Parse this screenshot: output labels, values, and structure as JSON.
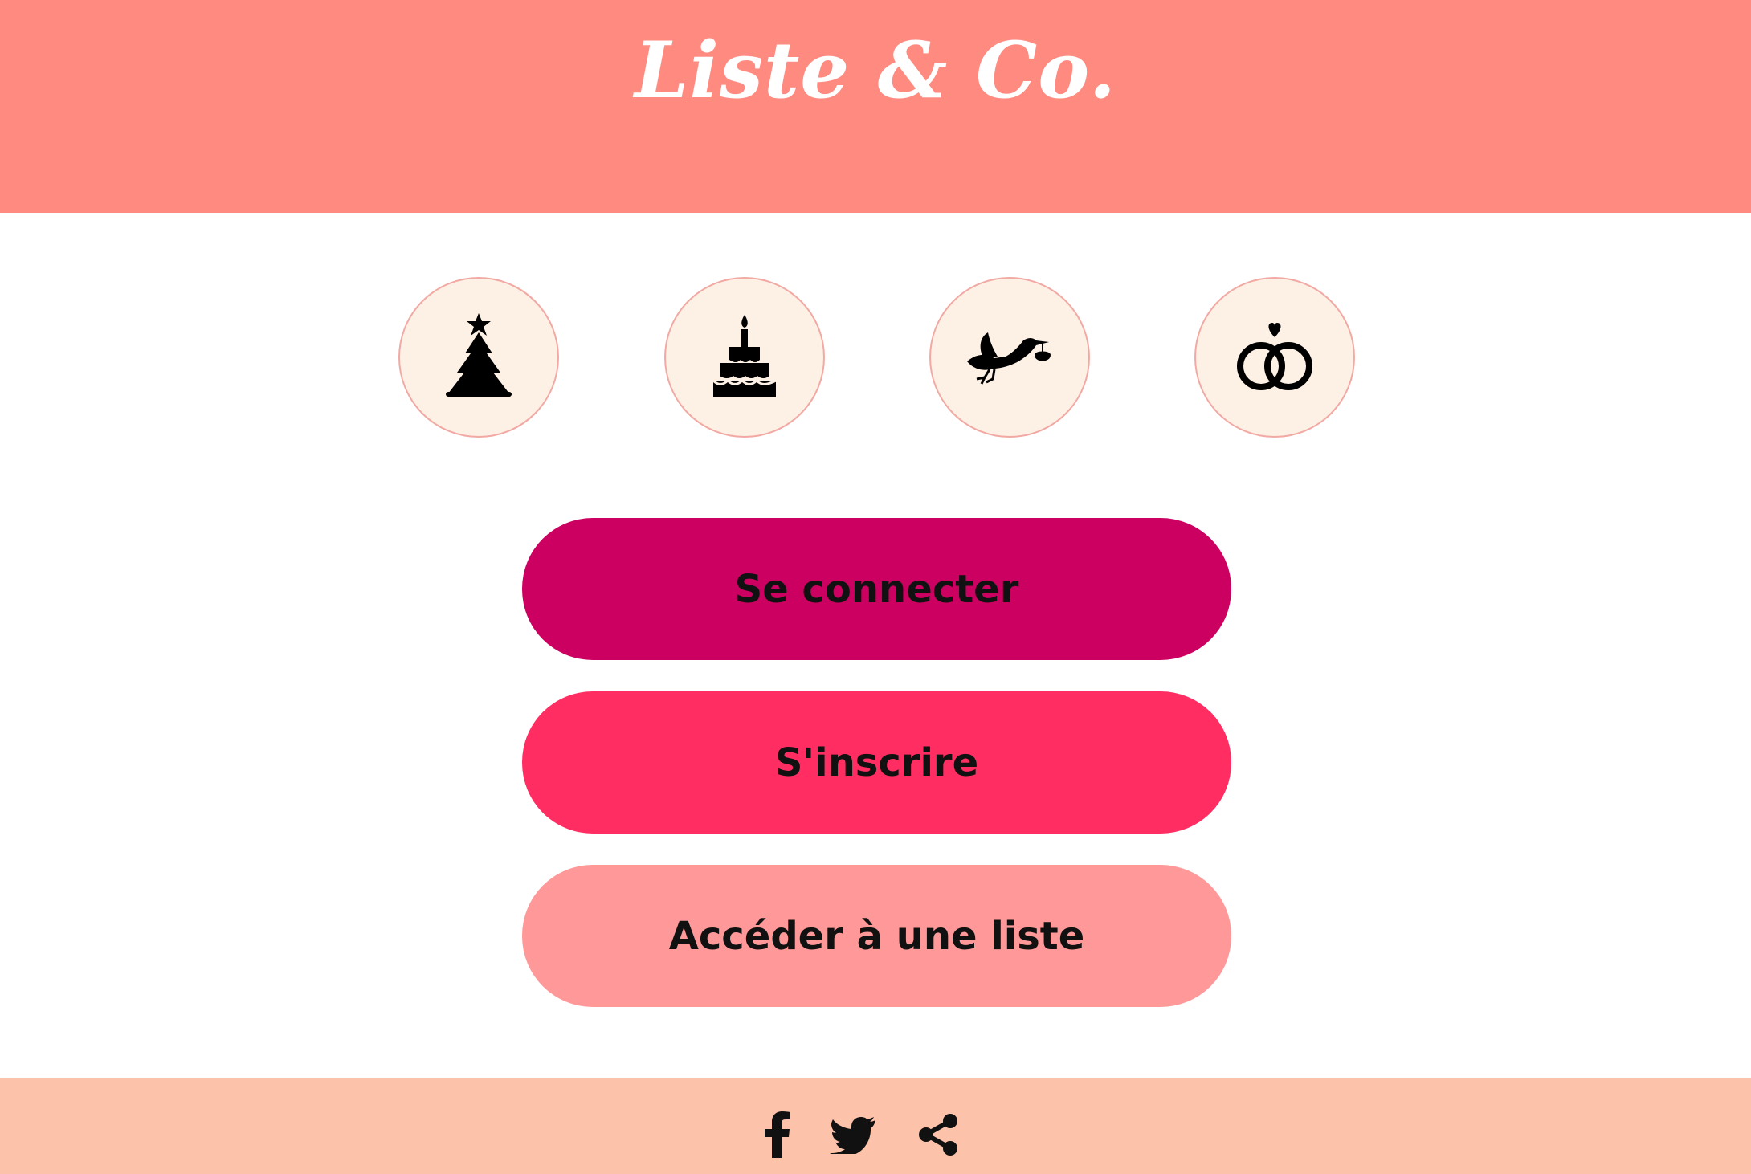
{
  "header": {
    "logo_text": "Liste & Co."
  },
  "categories": [
    {
      "icon": "christmas-tree-icon"
    },
    {
      "icon": "birthday-cake-icon"
    },
    {
      "icon": "stork-baby-icon"
    },
    {
      "icon": "wedding-rings-icon"
    }
  ],
  "actions": {
    "login_label": "Se connecter",
    "signup_label": "S'inscrire",
    "access_label": "Accéder à une liste"
  },
  "footer": {
    "social": [
      {
        "icon": "facebook-icon"
      },
      {
        "icon": "twitter-icon"
      },
      {
        "icon": "share-icon"
      }
    ]
  },
  "colors": {
    "header_bg": "#FF8A80",
    "circle_bg": "#FDF0E5",
    "circle_border": "#F2A9A3",
    "login_bg": "#CC0060",
    "signup_bg": "#FF2D62",
    "access_bg": "#FF9999",
    "footer_bg": "#FDC2AA"
  }
}
